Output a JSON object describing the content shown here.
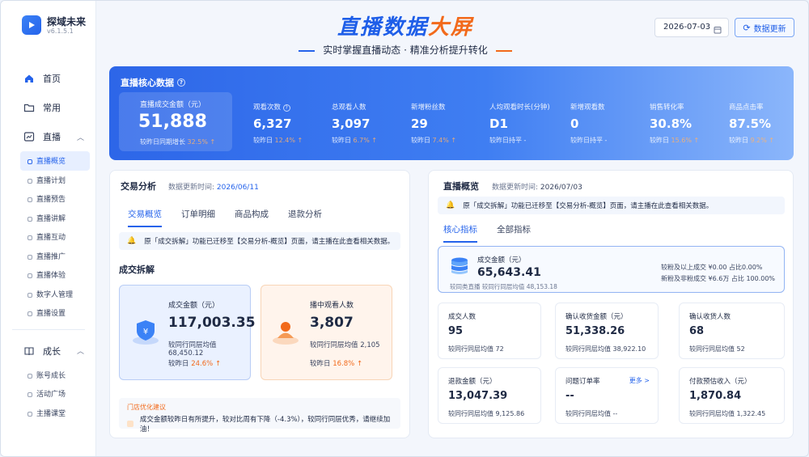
{
  "app": {
    "name": "探域未来",
    "version": "v6.1.5.1"
  },
  "header": {
    "title_main": "直播数据",
    "title_accent": "大屏",
    "subtitle": "实时掌握直播动态 · 精准分析提升转化",
    "date": "2026-07-03",
    "refresh_label": "数据更新"
  },
  "sidebar": {
    "items": [
      {
        "label": "首页",
        "icon": "home-icon"
      },
      {
        "label": "常用",
        "icon": "folder-icon"
      },
      {
        "label": "直播",
        "icon": "chart-icon"
      }
    ],
    "live_sub": [
      "直播概览",
      "直播计划",
      "直播预告",
      "直播讲解",
      "直播互动",
      "直播推广",
      "直播体验",
      "数字人管理",
      "直播设置"
    ],
    "growth": {
      "label": "成长",
      "icon": "book-icon"
    },
    "growth_sub": [
      "账号成长",
      "活动广场",
      "主播课堂"
    ]
  },
  "core": {
    "title": "直播核心数据",
    "main": {
      "label": "直播成交金额（元）",
      "value": "51,888",
      "compare_prefix": "较昨日同期增长",
      "compare_value": "32.5%",
      "arrow": "↑"
    },
    "kpis": [
      {
        "label": "观看次数",
        "value": "6,327",
        "compare_prefix": "较昨日",
        "compare_value": "12.4%",
        "arrow": "↑",
        "help": "?"
      },
      {
        "label": "总观看人数",
        "value": "3,097",
        "compare_prefix": "较昨日",
        "compare_value": "6.7%",
        "arrow": "↑"
      },
      {
        "label": "新增粉丝数",
        "value": "29",
        "compare_prefix": "较昨日",
        "compare_value": "7.4%",
        "arrow": "↑"
      },
      {
        "label": "人均观看时长(分钟)",
        "value": "D1",
        "compare_prefix": "较昨日持平",
        "compare_value": "-",
        "arrow": ""
      },
      {
        "label": "新增观看数",
        "value": "0",
        "compare_prefix": "较昨日持平",
        "compare_value": "-",
        "arrow": ""
      },
      {
        "label": "销售转化率",
        "value": "30.8%",
        "compare_prefix": "较昨日",
        "compare_value": "15.6%",
        "arrow": "↑"
      },
      {
        "label": "商品点击率",
        "value": "87.5%",
        "compare_prefix": "较昨日",
        "compare_value": "9.2%",
        "arrow": "↑"
      }
    ]
  },
  "trade": {
    "title": "交易分析",
    "meta_label": "数据更新时间:",
    "meta_date": "2026/06/11",
    "tabs": [
      "交易概览",
      "订单明细",
      "商品构成",
      "退款分析"
    ],
    "notice": "原「成交拆解」功能已迁移至【交易分析-概览】页面，请主播在此查看相关数据。",
    "section": "成交拆解",
    "tile1": {
      "label": "成交金额（元）",
      "value": "117,003.35",
      "peer": "较同行同层均值 68,450.12",
      "compare_prefix": "较昨日",
      "compare_value": "24.6%",
      "arrow": "↑",
      "icon": "yuan-shield-icon"
    },
    "tile2": {
      "label": "播中观看人数",
      "value": "3,807",
      "peer": "较同行同层均值 2,105",
      "compare_prefix": "较昨日",
      "compare_value": "16.8%",
      "arrow": "↑",
      "icon": "person-icon"
    },
    "advice_title": "门店优化建议",
    "advice_text": "成交金额较昨日有所提升，较对比周有下降（-4.3%），较同行同层优秀，请继续加油！"
  },
  "overview": {
    "title": "直播概览",
    "meta_label": "数据更新时间:",
    "meta_date": "2026/07/03",
    "notice": "原「成交拆解」功能已迁移至【交易分析-概览】页面，请主播在此查看相关数据。",
    "tabs": [
      "核心指标",
      "全部指标"
    ],
    "core_tile": {
      "label": "成交金额（元）",
      "value": "65,643.41",
      "compare": "较同类直播 较同行同层均值 48,153.18",
      "right1": "较粉及以上成交 ¥0.00  占比0.00%",
      "right2": "新粉及非粉成交 ¥6.6万  占比 100.00%"
    },
    "tiles": [
      {
        "label": "成交人数",
        "value": "95",
        "peer": "较同行同层均值 72"
      },
      {
        "label": "确认收货金额（元）",
        "value": "51,338.26",
        "peer": "较同行同层均值 38,922.10"
      },
      {
        "label": "确认收货人数",
        "value": "68",
        "peer": "较同行同层均值 52"
      },
      {
        "label": "退款金额（元）",
        "value": "13,047.39",
        "peer": "较同行同层均值 9,125.86"
      },
      {
        "label": "问题订单率",
        "value": "--",
        "peer": "较同行同层均值 --",
        "more": "更多 >"
      },
      {
        "label": "付款预估收入（元）",
        "value": "1,870.84",
        "peer": "较同行同层均值 1,322.45"
      }
    ]
  },
  "colors": {
    "primary": "#2563eb",
    "accent": "#f26a1b",
    "panel_start": "#2d66e8",
    "panel_end": "#8bb6fb"
  }
}
